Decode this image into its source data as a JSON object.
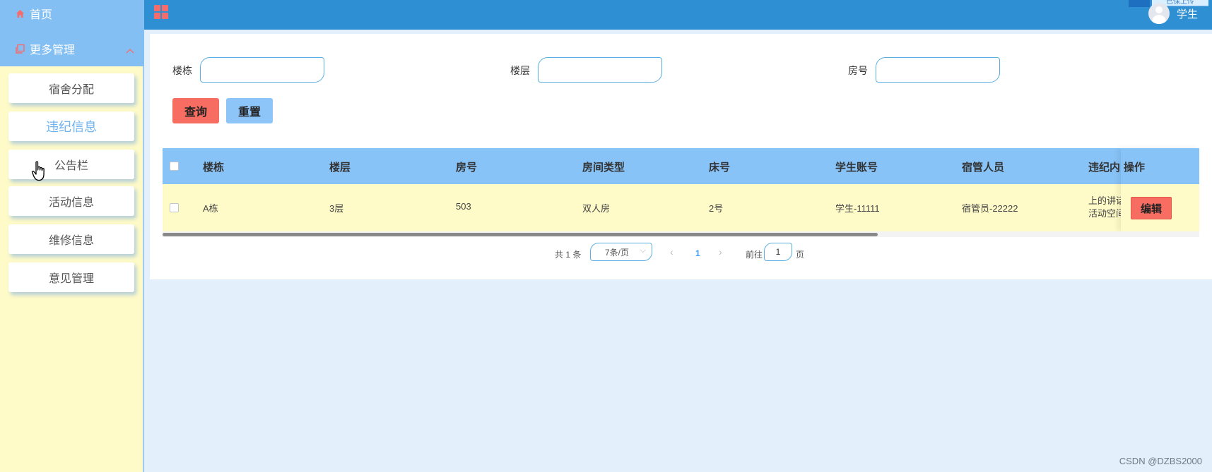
{
  "sidebar": {
    "home_label": "首页",
    "more_label": "更多管理",
    "sub_items": [
      {
        "label": "宿舍分配",
        "active": false
      },
      {
        "label": "违纪信息",
        "active": true
      },
      {
        "label": "公告栏",
        "active": false
      },
      {
        "label": "活动信息",
        "active": false
      },
      {
        "label": "维修信息",
        "active": false
      },
      {
        "label": "意见管理",
        "active": false
      }
    ]
  },
  "header": {
    "user_name": "学生",
    "upload_badge": "已保上传"
  },
  "search": {
    "building_label": "楼栋",
    "floor_label": "楼层",
    "room_label": "房号",
    "building_value": "",
    "floor_value": "",
    "room_value": "",
    "query_button": "查询",
    "reset_button": "重置"
  },
  "table": {
    "columns": [
      "楼栋",
      "楼层",
      "房号",
      "房间类型",
      "床号",
      "学生账号",
      "宿管人员",
      "违纪内",
      "操作"
    ],
    "rows": [
      {
        "building": "A栋",
        "floor": "3层",
        "room": "503",
        "room_type": "双人房",
        "bed": "2号",
        "student_account": "学生-11111",
        "manager": "宿管员-22222",
        "violation_line1": "上的讲话",
        "violation_line2": "活动空间",
        "edit_label": "编辑"
      }
    ]
  },
  "pagination": {
    "total": "共 1 条",
    "page_size": "7条/页",
    "current_page": "1",
    "goto_label": "前往",
    "goto_value": "1",
    "page_suffix": "页"
  },
  "watermark": "CSDN @DZBS2000",
  "colors": {
    "sidebar_bg": "#fffbc8",
    "sidebar_top": "#84bff3",
    "header_bg": "#2e8fd3",
    "table_head": "#88c3f7",
    "query_btn": "#f86d62",
    "reset_btn": "#8dc5f8",
    "content_bg": "#e3f0fb"
  }
}
